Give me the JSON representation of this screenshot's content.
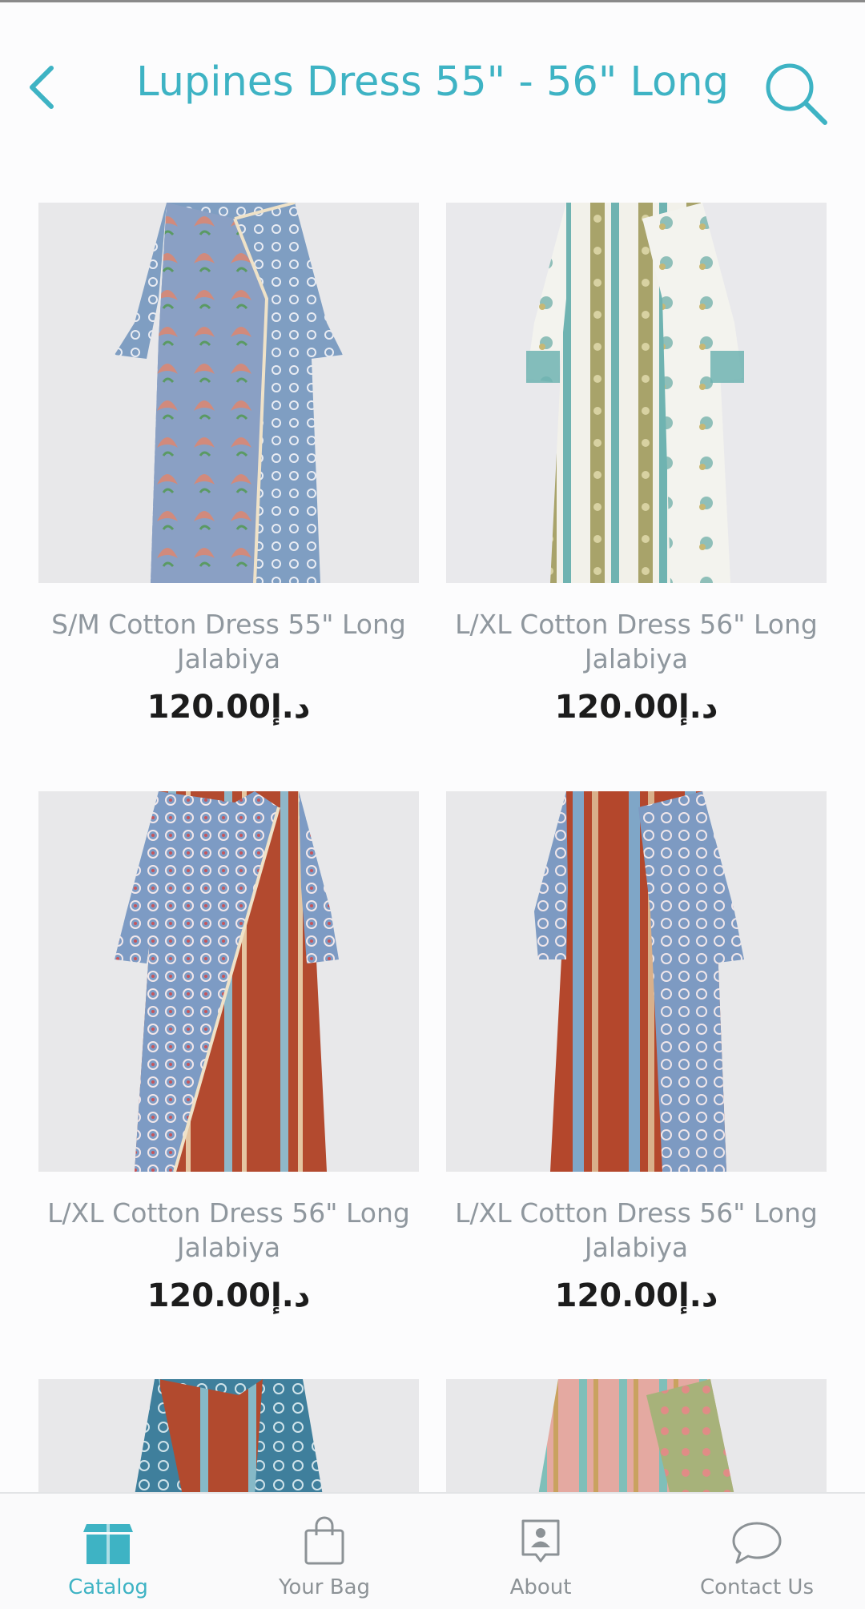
{
  "header": {
    "title": "Lupines Dress 55\" - 56\" Long",
    "back_icon": "chevron-left-icon",
    "search_icon": "search-icon",
    "accent_color": "#3eb3c4"
  },
  "products": [
    {
      "name": "S/M Cotton Dress 55\" Long Jalabiya",
      "price": "د.إ120.00",
      "image": "blue floral wrap dress with pink leaf print"
    },
    {
      "name": "L/XL Cotton Dress 56\" Long Jalabiya",
      "price": "د.إ120.00",
      "image": "white and olive striped dress with teal stripes"
    },
    {
      "name": "L/XL Cotton Dress 56\" Long Jalabiya",
      "price": "د.إ120.00",
      "image": "blue dotted and rust striped wrap dress"
    },
    {
      "name": "L/XL Cotton Dress 56\" Long Jalabiya",
      "price": "د.إ120.00",
      "image": "rust and blue striped wrap dress"
    },
    {
      "name": "",
      "price": "",
      "image": "teal and rust patterned dress"
    },
    {
      "name": "",
      "price": "",
      "image": "pink and green floral striped dress"
    }
  ],
  "tabbar": {
    "tabs": [
      {
        "label": "Catalog",
        "icon": "box-icon",
        "active": true
      },
      {
        "label": "Your Bag",
        "icon": "shopping-bag-icon",
        "active": false
      },
      {
        "label": "About",
        "icon": "contact-card-icon",
        "active": false
      },
      {
        "label": "Contact Us",
        "icon": "chat-bubble-icon",
        "active": false
      }
    ]
  }
}
